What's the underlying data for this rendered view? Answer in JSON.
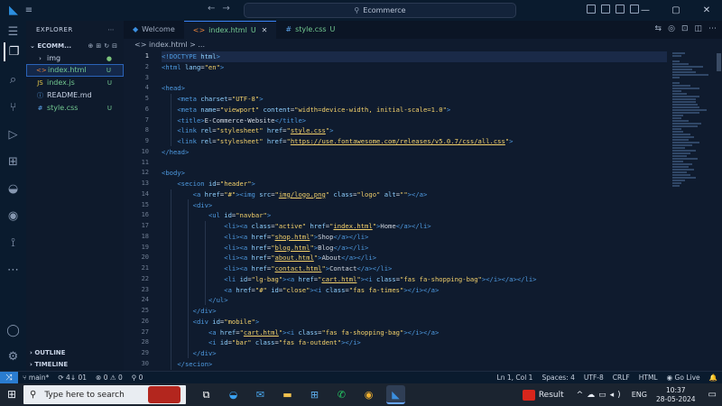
{
  "window": {
    "search_text": "Ecommerce",
    "controls": [
      "—",
      "▢",
      "✕"
    ]
  },
  "sidebar": {
    "header": "EXPLORER",
    "folder": "ECOMM...",
    "items": [
      {
        "icon": "›",
        "label": "img",
        "badge": "●",
        "color": "#7cc47c"
      },
      {
        "icon": "<>",
        "label": "index.html",
        "badge": "U",
        "color": "#73c991"
      },
      {
        "icon": "JS",
        "label": "index.js",
        "badge": "U",
        "color": "#73c991"
      },
      {
        "icon": "ⓘ",
        "label": "README.md",
        "badge": "",
        "color": "#c8d3e6"
      },
      {
        "icon": "#",
        "label": "style.css",
        "badge": "U",
        "color": "#73c991"
      }
    ],
    "outline": "OUTLINE",
    "timeline": "TIMELINE"
  },
  "tabs": [
    {
      "label": "Welcome",
      "icon": "◆",
      "suffix": ""
    },
    {
      "label": "index.html",
      "icon": "<>",
      "suffix": "U"
    },
    {
      "label": "style.css",
      "icon": "#",
      "suffix": "U"
    }
  ],
  "breadcrumb": "<> index.html > ...",
  "editor": {
    "line_numbers": [
      "1",
      "2",
      "3",
      "4",
      "5",
      "6",
      "7",
      "8",
      "9",
      "10",
      "11",
      "12",
      "13",
      "14",
      "15",
      "16",
      "17",
      "18",
      "19",
      "20",
      "21",
      "22",
      "23",
      "24",
      "25",
      "26",
      "27",
      "28",
      "29",
      "30"
    ]
  },
  "status": {
    "branch": "main*",
    "sync": "⟳ 4↓ 01",
    "problems": "⊗ 0 ⚠ 0",
    "ports": "⚲ 0",
    "position": "Ln 1, Col 1",
    "spaces": "Spaces: 4",
    "encoding": "UTF-8",
    "eol": "CRLF",
    "language": "HTML",
    "go_live": "Go Live",
    "bell": "🔔"
  },
  "taskbar": {
    "search_placeholder": "Type here to search",
    "result_label": "Result",
    "lang": "ENG",
    "time": "10:37",
    "date": "28-05-2024"
  }
}
